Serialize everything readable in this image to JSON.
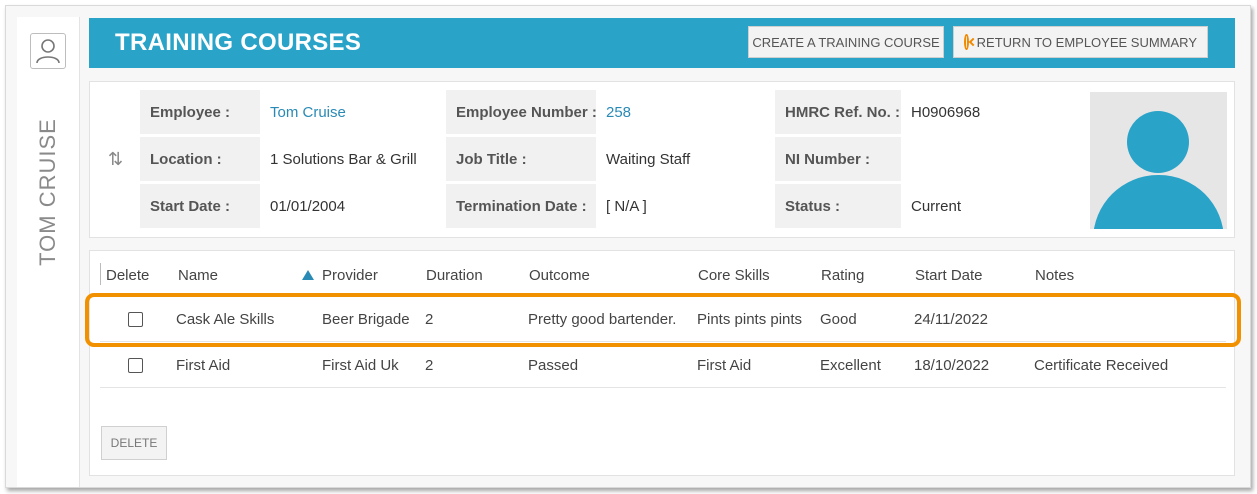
{
  "sidebar": {
    "employee_name": "TOM CRUISE",
    "icon": "user-icon"
  },
  "header": {
    "title": "TRAINING COURSES",
    "create_label": "CREATE A TRAINING COURSE",
    "return_label": "RETURN TO EMPLOYEE SUMMARY",
    "color": "#2aa3c9"
  },
  "employee": {
    "employee_label": "Employee :",
    "employee_value": "Tom Cruise",
    "number_label": "Employee Number :",
    "number_value": "258",
    "hmrc_label": "HMRC Ref. No. :",
    "hmrc_value": "H0906968",
    "location_label": "Location :",
    "location_value": "1 Solutions Bar & Grill",
    "job_label": "Job Title :",
    "job_value": "Waiting Staff",
    "ni_label": "NI Number :",
    "ni_value": "",
    "start_label": "Start Date :",
    "start_value": "01/01/2004",
    "termination_label": "Termination Date :",
    "termination_value": "[ N/A ]",
    "status_label": "Status :",
    "status_value": "Current"
  },
  "courses": {
    "columns": [
      "Delete",
      "Name",
      "Provider",
      "Duration",
      "Outcome",
      "Core Skills",
      "Rating",
      "Start Date",
      "Notes"
    ],
    "rows": [
      {
        "name": "Cask Ale Skills",
        "provider": "Beer Brigade",
        "duration": "2",
        "outcome": "Pretty good bartender.",
        "core_skills": "Pints pints pints",
        "rating": "Good",
        "start_date": "24/11/2022",
        "notes": "",
        "checked": false
      },
      {
        "name": "First Aid",
        "provider": "First Aid Uk",
        "duration": "2",
        "outcome": "Passed",
        "core_skills": "First Aid",
        "rating": "Excellent",
        "start_date": "18/10/2022",
        "notes": "Certificate Received",
        "checked": false
      }
    ],
    "delete_label": "DELETE"
  },
  "highlight_color": "#f29100"
}
